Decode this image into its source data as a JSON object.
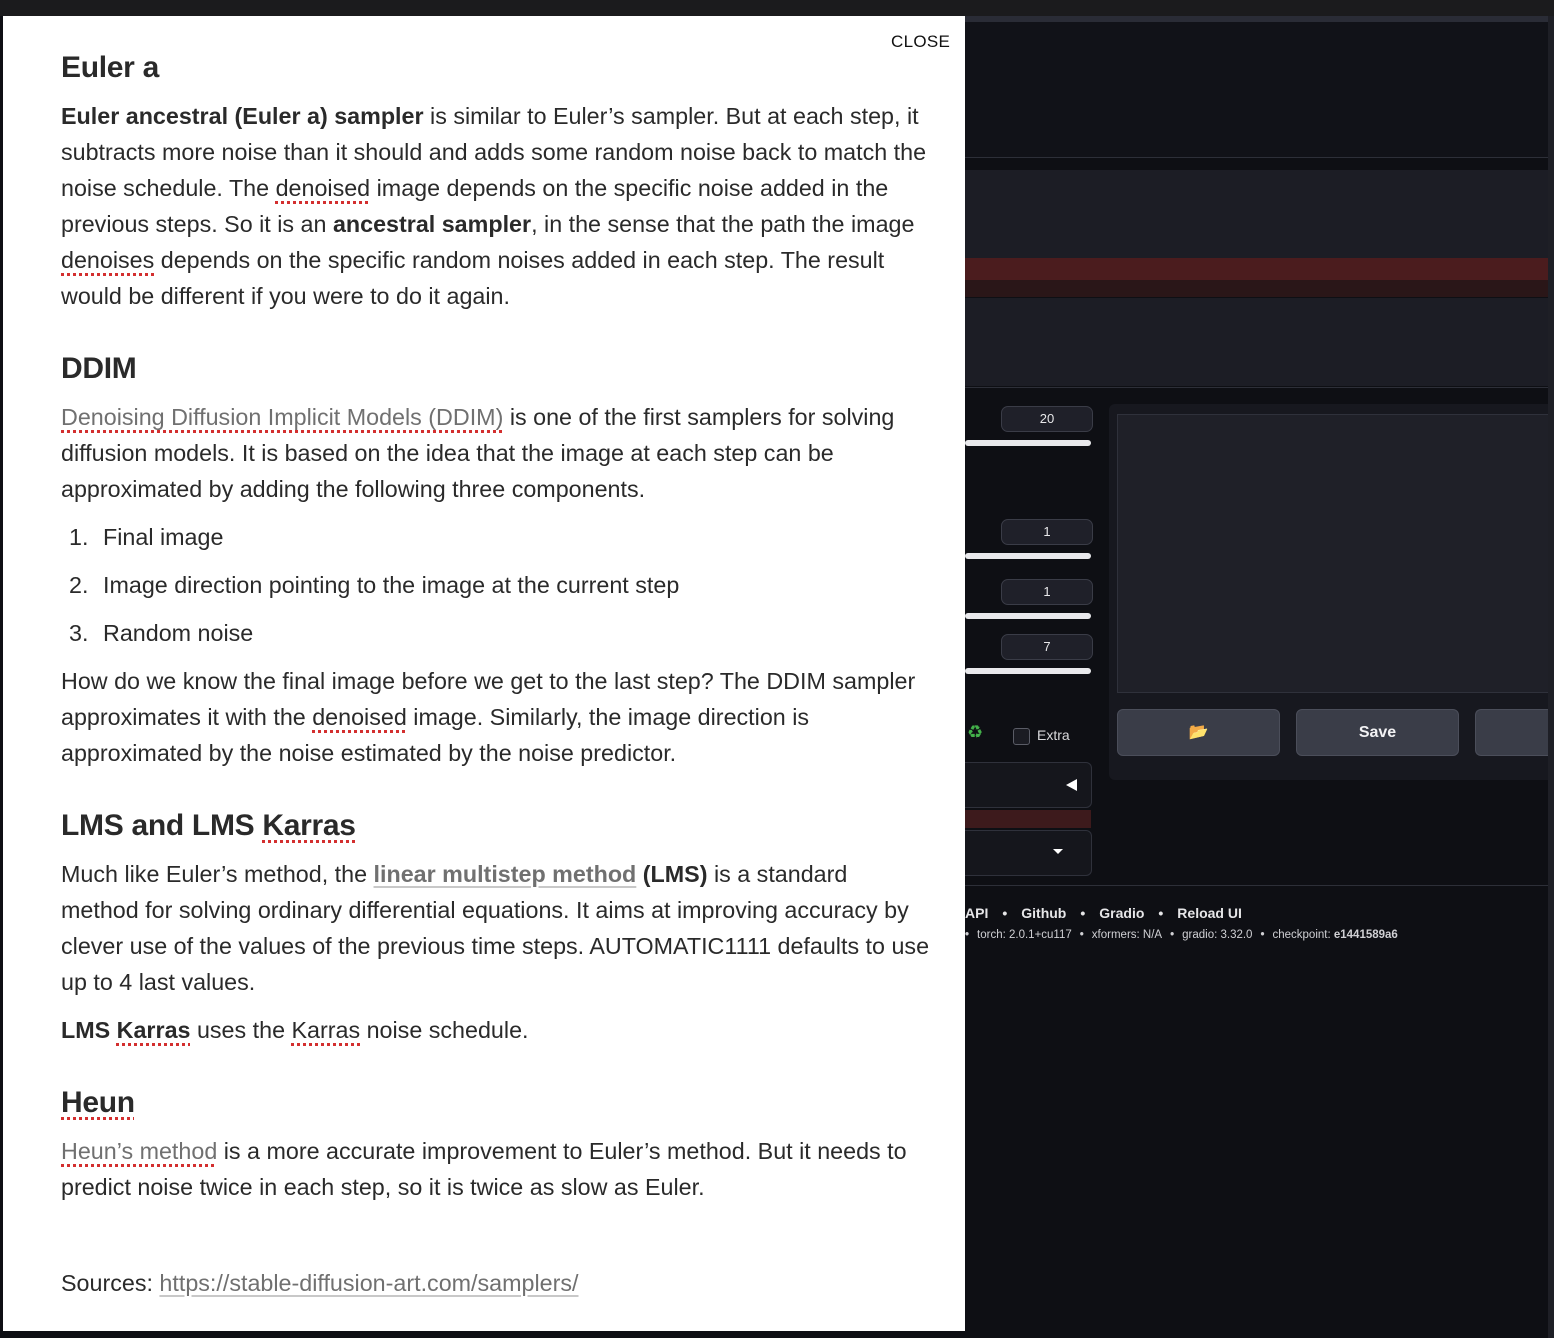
{
  "modal": {
    "close_label": "CLOSE",
    "euler_a": {
      "title": "Euler a",
      "p1_bold1": "Euler ancestral (Euler a) sampler",
      "p1_t1": " is similar to Euler’s sampler. But at each step, it subtracts more noise than it should and adds some random noise back to match the noise schedule. The ",
      "p1_sp1": "denoised",
      "p1_t2": " image depends on the specific noise added in the previous steps. So it is an ",
      "p1_bold2": "ancestral sampler",
      "p1_t3": ", in the sense that the path the image ",
      "p1_sp2": "denoises",
      "p1_t4": " depends on the specific random noises added in each step. The result would be different if you were to do it again."
    },
    "ddim": {
      "title": "DDIM",
      "p1_link": "Denoising Diffusion Implicit Models (DDIM)",
      "p1_t1": " is one of the first samplers for solving diffusion models. It is based on the idea that the image at each step can be approximated by adding the following three components.",
      "list": [
        {
          "n": "1.",
          "text": "Final image"
        },
        {
          "n": "2.",
          "text": "Image direction pointing to the image at the current step"
        },
        {
          "n": "3.",
          "text": "Random noise"
        }
      ],
      "p2_t1": "How do we know the final image before we get to the last step? The DDIM sampler approximates it with the ",
      "p2_sp1": "denoised",
      "p2_t2": " image. Similarly, the image direction is approximated by the noise estimated by the noise predictor."
    },
    "lms": {
      "title_a": "LMS and LMS ",
      "title_sp": "Karras",
      "p1_t1": "Much like Euler’s method, the ",
      "p1_link": "linear multistep method",
      "p1_bold": " (LMS)",
      "p1_t2": " is a standard method for solving ordinary differential equations. It aims at improving accuracy by clever use of the values of the previous time steps. AUTOMATIC1111 defaults to use up to 4 last values.",
      "p2_bold1": "LMS ",
      "p2_bold_sp": "Karras",
      "p2_t1": " uses the ",
      "p2_sp": "Karras",
      "p2_t2": " noise schedule."
    },
    "heun": {
      "title": "Heun",
      "p1_link": "Heun’s method",
      "p1_t1": " is a more accurate improvement to Euler’s method. But it needs to predict noise twice in each step, so it is twice as slow as Euler."
    },
    "sources_label": "Sources: ",
    "sources_url": "https://stable-diffusion-art.com/samplers/"
  },
  "background": {
    "sliders": [
      {
        "name": "steps",
        "value": "20"
      },
      {
        "name": "batch-count",
        "value": "1"
      },
      {
        "name": "batch-size",
        "value": "1"
      },
      {
        "name": "cfg-scale",
        "value": "7"
      }
    ],
    "extra_label": "Extra",
    "save_label": "Save",
    "footer": {
      "links": [
        "API",
        "Github",
        "Gradio",
        "Reload UI"
      ],
      "info_prefix": "torch: 2.0.1+cu117",
      "info_xformers": "xformers: N/A",
      "info_gradio": "gradio: 3.32.0",
      "info_checkpoint_label": "checkpoint: ",
      "info_checkpoint_value": "e1441589a6"
    }
  }
}
